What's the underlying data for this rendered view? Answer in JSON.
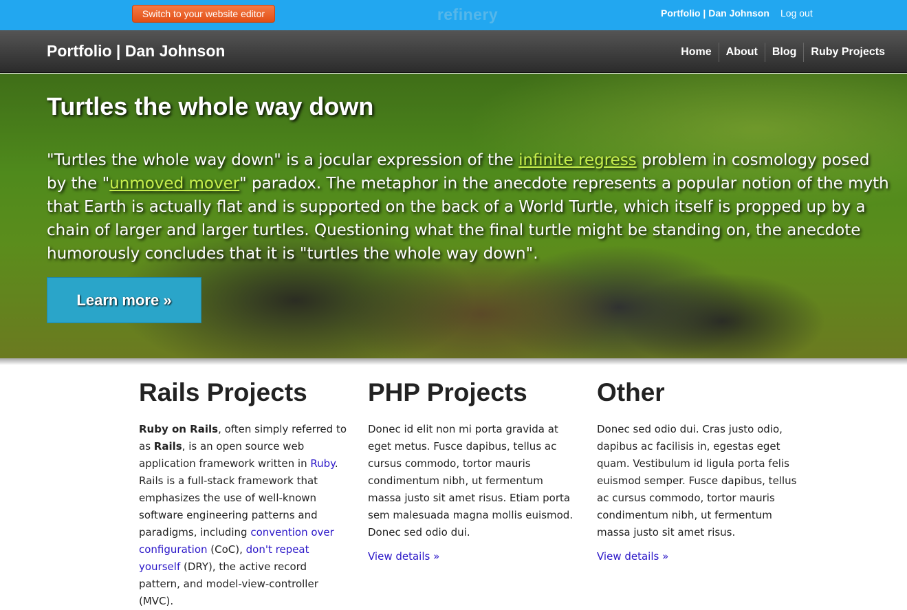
{
  "admin_bar": {
    "editor_button": "Switch to your website editor",
    "logo": "refinery",
    "site_link": "Portfolio | Dan Johnson",
    "logout": "Log out"
  },
  "navbar": {
    "brand": "Portfolio | Dan Johnson",
    "items": [
      {
        "label": "Home"
      },
      {
        "label": "About"
      },
      {
        "label": "Blog"
      },
      {
        "label": "Ruby Projects"
      }
    ]
  },
  "hero": {
    "title": "Turtles the whole way down",
    "text_1": "\"Turtles the whole way down\" is a jocular expression of the ",
    "link_1": "infinite regress",
    "text_2": " problem in cosmology posed by the \"",
    "link_2": "unmoved mover",
    "text_3": "\" paradox. The metaphor in the anecdote represents a popular notion of the myth that Earth is actually flat and is supported on the back of a World Turtle, which itself is propped up by a chain of larger and larger turtles. Questioning what the final turtle might be standing on, the anecdote humorously concludes that it is \"turtles the whole way down\".",
    "button": "Learn more »"
  },
  "columns": [
    {
      "heading": "Rails Projects",
      "bold_1": "Ruby on Rails",
      "t1": ", often simply referred to as ",
      "bold_2": "Rails",
      "t2": ", is an open source web application framework written in ",
      "link_ruby": "Ruby",
      "t3": ". Rails is a full-stack framework that emphasizes the use of well-known software engineering patterns and paradigms, including ",
      "link_coc": "convention over configuration",
      "t4": " (CoC), ",
      "link_dry": "don't repeat yourself",
      "t5": " (DRY), the active record pattern, and model-view-controller (MVC)."
    },
    {
      "heading": "PHP Projects",
      "text": "Donec id elit non mi porta gravida at eget metus. Fusce dapibus, tellus ac cursus commodo, tortor mauris condimentum nibh, ut fermentum massa justo sit amet risus. Etiam porta sem malesuada magna mollis euismod. Donec sed odio dui.",
      "details": "View details »"
    },
    {
      "heading": "Other",
      "text": "Donec sed odio dui. Cras justo odio, dapibus ac facilisis in, egestas eget quam. Vestibulum id ligula porta felis euismod semper. Fusce dapibus, tellus ac cursus commodo, tortor mauris condimentum nibh, ut fermentum massa justo sit amet risus.",
      "details": "View details »"
    }
  ],
  "colors": {
    "admin_bar": "#22a7f0",
    "editor_button": "#e8581f",
    "learn_button": "#2aa5c9",
    "hero_link": "#c7ef4d",
    "body_link": "#2a16c8"
  }
}
